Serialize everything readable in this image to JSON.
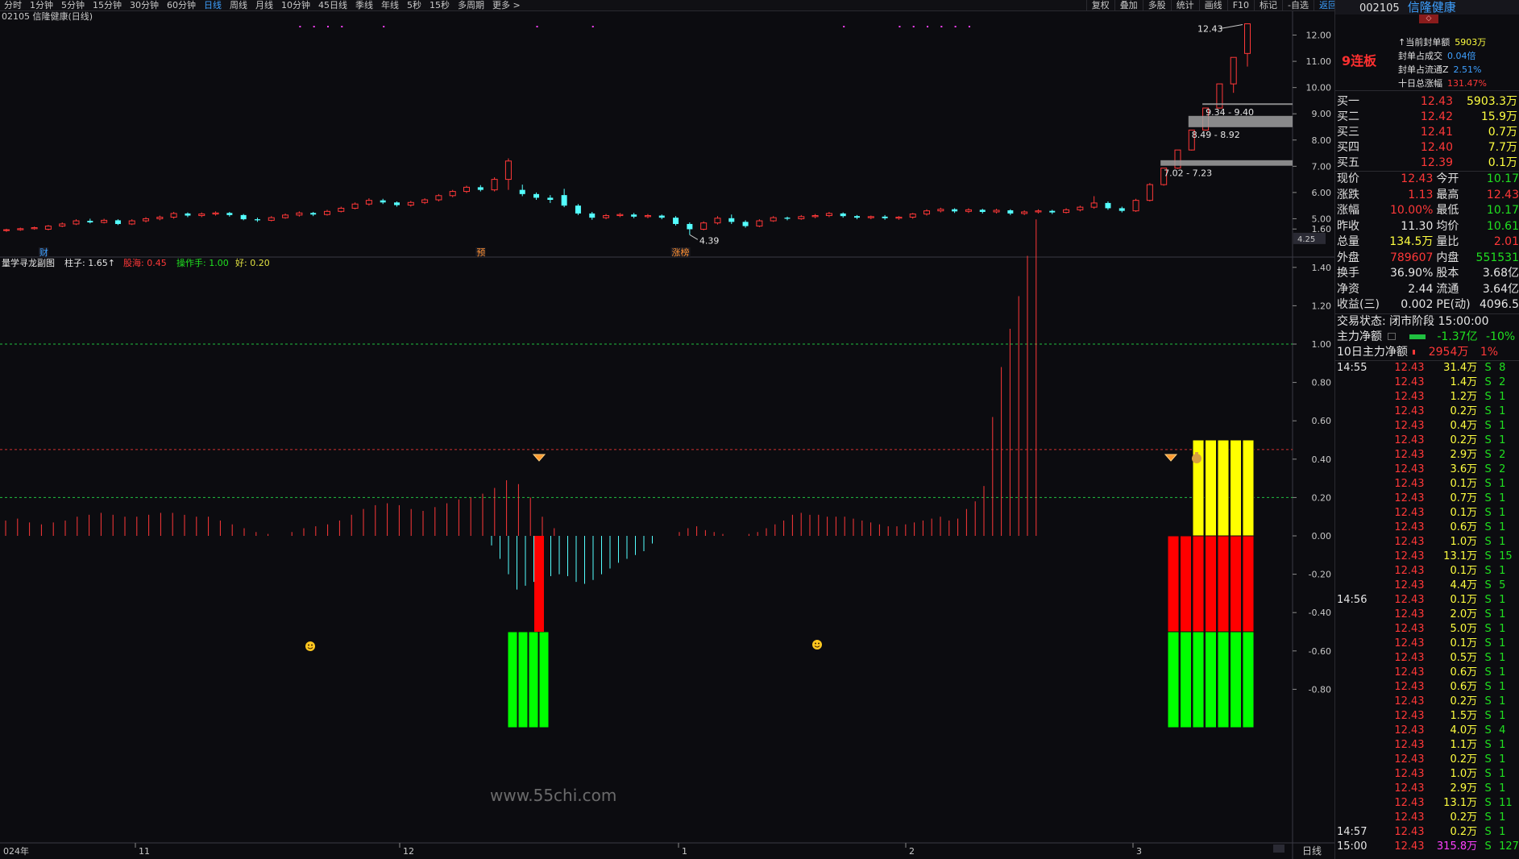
{
  "period_tabs": [
    {
      "label": "分时",
      "active": false
    },
    {
      "label": "1分钟",
      "active": false
    },
    {
      "label": "5分钟",
      "active": false
    },
    {
      "label": "15分钟",
      "active": false
    },
    {
      "label": "30分钟",
      "active": false
    },
    {
      "label": "60分钟",
      "active": false
    },
    {
      "label": "日线",
      "active": true
    },
    {
      "label": "周线",
      "active": false
    },
    {
      "label": "月线",
      "active": false
    },
    {
      "label": "10分钟",
      "active": false
    },
    {
      "label": "45日线",
      "active": false
    },
    {
      "label": "季线",
      "active": false
    },
    {
      "label": "年线",
      "active": false
    },
    {
      "label": "5秒",
      "active": false
    },
    {
      "label": "15秒",
      "active": false
    },
    {
      "label": "多周期",
      "active": false
    },
    {
      "label": "更多 >",
      "active": false
    }
  ],
  "right_tabs": [
    {
      "label": "复权",
      "active": false
    },
    {
      "label": "叠加",
      "active": false
    },
    {
      "label": "多股",
      "active": false
    },
    {
      "label": "统计",
      "active": false
    },
    {
      "label": "画线",
      "active": false
    },
    {
      "label": "F10",
      "active": false
    },
    {
      "label": "标记",
      "active": false
    },
    {
      "label": "-自选",
      "active": false
    },
    {
      "label": "返回",
      "active": true
    }
  ],
  "main_chart": {
    "title": "02105 信隆健康(日线)",
    "price_axis": [
      "12.00",
      "11.00",
      "10.00",
      "9.00",
      "8.00",
      "7.00",
      "6.00",
      "5.00"
    ],
    "last_price_tag": "4.25",
    "annotations": {
      "high": "12.43",
      "low": "4.39"
    },
    "zones": [
      {
        "label": "9.34 - 9.40",
        "lo": 9.34,
        "hi": 9.4
      },
      {
        "label": "8.49 - 8.92",
        "lo": 8.49,
        "hi": 8.92
      },
      {
        "label": "7.02 - 7.23",
        "lo": 7.02,
        "hi": 7.23
      }
    ],
    "markers": [
      {
        "label": "财",
        "index": 3,
        "color": "#3ea0ff"
      },
      {
        "label": "预",
        "index": 34,
        "color": "#ff9030"
      },
      {
        "label": "涨榜",
        "index": 48,
        "color": "#ff9030"
      }
    ],
    "x_axis": [
      "024年",
      "11",
      "12",
      "1",
      "2",
      "3"
    ],
    "period_label": "日线",
    "watermark": "www.55chi.com"
  },
  "indicator": {
    "name": "量学寻龙副图",
    "legend": [
      {
        "text": "柱子: 1.65↑",
        "color": "#e6e6e6"
      },
      {
        "text": "股海: 0.45",
        "color": "#ff3838"
      },
      {
        "text": "操作手: 1.00",
        "color": "#20e020"
      },
      {
        "text": "好: 0.20",
        "color": "#e0e040"
      }
    ],
    "axis": [
      "1.60",
      "1.40",
      "1.20",
      "1.00",
      "0.80",
      "0.60",
      "0.40",
      "0.20",
      "0.00",
      "-0.20",
      "-0.40",
      "-0.60",
      "-0.80"
    ]
  },
  "chart_data": {
    "type": "candlestick",
    "ylim": [
      4.0,
      12.6
    ],
    "candles": [
      [
        4.55,
        4.58,
        4.5,
        4.62
      ],
      [
        4.58,
        4.62,
        4.54,
        4.66
      ],
      [
        4.62,
        4.66,
        4.58,
        4.7
      ],
      [
        4.6,
        4.72,
        4.56,
        4.76
      ],
      [
        4.72,
        4.8,
        4.68,
        4.86
      ],
      [
        4.8,
        4.92,
        4.76,
        4.98
      ],
      [
        4.92,
        4.86,
        4.82,
        5.0
      ],
      [
        4.86,
        4.94,
        4.82,
        5.0
      ],
      [
        4.94,
        4.8,
        4.76,
        4.98
      ],
      [
        4.8,
        4.92,
        4.76,
        4.98
      ],
      [
        4.92,
        5.0,
        4.86,
        5.06
      ],
      [
        5.0,
        5.06,
        4.94,
        5.12
      ],
      [
        5.06,
        5.2,
        5.0,
        5.26
      ],
      [
        5.2,
        5.12,
        5.06,
        5.24
      ],
      [
        5.12,
        5.18,
        5.06,
        5.24
      ],
      [
        5.18,
        5.22,
        5.12,
        5.28
      ],
      [
        5.22,
        5.14,
        5.08,
        5.26
      ],
      [
        5.14,
        4.98,
        4.94,
        5.18
      ],
      [
        4.98,
        4.94,
        4.88,
        5.04
      ],
      [
        4.94,
        5.04,
        4.9,
        5.1
      ],
      [
        5.04,
        5.14,
        5.0,
        5.2
      ],
      [
        5.14,
        5.22,
        5.08,
        5.28
      ],
      [
        5.22,
        5.16,
        5.1,
        5.26
      ],
      [
        5.16,
        5.28,
        5.12,
        5.34
      ],
      [
        5.28,
        5.4,
        5.24,
        5.46
      ],
      [
        5.4,
        5.56,
        5.36,
        5.62
      ],
      [
        5.56,
        5.7,
        5.5,
        5.78
      ],
      [
        5.7,
        5.62,
        5.56,
        5.76
      ],
      [
        5.62,
        5.52,
        5.46,
        5.66
      ],
      [
        5.52,
        5.62,
        5.46,
        5.68
      ],
      [
        5.62,
        5.72,
        5.56,
        5.78
      ],
      [
        5.72,
        5.88,
        5.66,
        5.94
      ],
      [
        5.88,
        6.04,
        5.82,
        6.1
      ],
      [
        6.04,
        6.2,
        5.98,
        6.26
      ],
      [
        6.2,
        6.1,
        6.04,
        6.28
      ],
      [
        6.1,
        6.5,
        6.04,
        6.58
      ],
      [
        6.5,
        7.2,
        6.1,
        7.3
      ],
      [
        6.1,
        5.94,
        5.86,
        6.3
      ],
      [
        5.94,
        5.8,
        5.72,
        6.0
      ],
      [
        5.8,
        5.72,
        5.6,
        5.9
      ],
      [
        5.9,
        5.5,
        5.44,
        6.14
      ],
      [
        5.5,
        5.2,
        5.14,
        5.56
      ],
      [
        5.2,
        5.04,
        4.96,
        5.26
      ],
      [
        5.04,
        5.12,
        4.98,
        5.18
      ],
      [
        5.12,
        5.16,
        5.06,
        5.22
      ],
      [
        5.16,
        5.08,
        5.02,
        5.22
      ],
      [
        5.08,
        5.12,
        5.02,
        5.18
      ],
      [
        5.12,
        5.04,
        4.98,
        5.16
      ],
      [
        5.04,
        4.8,
        4.74,
        5.1
      ],
      [
        4.8,
        4.6,
        4.39,
        4.86
      ],
      [
        4.6,
        4.84,
        4.56,
        4.9
      ],
      [
        4.84,
        5.02,
        4.78,
        5.1
      ],
      [
        5.02,
        4.88,
        4.8,
        5.16
      ],
      [
        4.88,
        4.72,
        4.66,
        4.94
      ],
      [
        4.72,
        4.92,
        4.68,
        4.98
      ],
      [
        4.92,
        5.04,
        4.88,
        5.1
      ],
      [
        5.04,
        5.0,
        4.94,
        5.08
      ],
      [
        5.0,
        5.08,
        4.96,
        5.14
      ],
      [
        5.08,
        5.12,
        5.02,
        5.18
      ],
      [
        5.12,
        5.2,
        5.06,
        5.26
      ],
      [
        5.2,
        5.1,
        5.04,
        5.24
      ],
      [
        5.1,
        5.04,
        4.98,
        5.14
      ],
      [
        5.04,
        5.08,
        4.98,
        5.12
      ],
      [
        5.08,
        5.02,
        4.96,
        5.14
      ],
      [
        5.02,
        5.06,
        4.96,
        5.1
      ],
      [
        5.06,
        5.18,
        5.0,
        5.22
      ],
      [
        5.18,
        5.3,
        5.12,
        5.36
      ],
      [
        5.3,
        5.36,
        5.24,
        5.42
      ],
      [
        5.36,
        5.28,
        5.22,
        5.4
      ],
      [
        5.28,
        5.34,
        5.22,
        5.4
      ],
      [
        5.34,
        5.26,
        5.2,
        5.38
      ],
      [
        5.26,
        5.32,
        5.2,
        5.38
      ],
      [
        5.32,
        5.2,
        5.14,
        5.36
      ],
      [
        5.2,
        5.26,
        5.14,
        5.32
      ],
      [
        5.26,
        5.3,
        5.2,
        5.36
      ],
      [
        5.3,
        5.24,
        5.18,
        5.34
      ],
      [
        5.24,
        5.34,
        5.2,
        5.4
      ],
      [
        5.34,
        5.44,
        5.28,
        5.5
      ],
      [
        5.44,
        5.6,
        5.38,
        5.86
      ],
      [
        5.6,
        5.4,
        5.34,
        5.66
      ],
      [
        5.4,
        5.3,
        5.24,
        5.46
      ],
      [
        5.3,
        5.7,
        5.26,
        5.76
      ],
      [
        5.7,
        6.3,
        5.66,
        6.36
      ],
      [
        6.3,
        6.93,
        6.26,
        6.93
      ],
      [
        6.93,
        7.62,
        6.9,
        7.62
      ],
      [
        7.62,
        8.38,
        7.6,
        8.38
      ],
      [
        8.38,
        9.22,
        8.36,
        9.22
      ],
      [
        9.22,
        10.14,
        9.2,
        10.14
      ],
      [
        10.14,
        11.15,
        9.8,
        11.15
      ],
      [
        11.3,
        12.43,
        10.8,
        12.43
      ]
    ],
    "colors": {
      "up": "#ff3838",
      "down": "#54ffff"
    }
  },
  "indicator_data": {
    "red_bars": [
      0.08,
      0.09,
      0.07,
      0.06,
      0.07,
      0.08,
      0.1,
      0.11,
      0.12,
      0.11,
      0.1,
      0.1,
      0.11,
      0.12,
      0.12,
      0.11,
      0.1,
      0.1,
      0.08,
      0.06,
      0.04,
      0.02,
      0.01,
      0.0,
      0.02,
      0.04,
      0.05,
      0.06,
      0.08,
      0.11,
      0.14,
      0.16,
      0.17,
      0.16,
      0.14,
      0.13,
      0.15,
      0.17,
      0.19,
      0.2,
      0.22,
      0.25,
      0.29,
      0.27,
      0.2,
      0.1,
      0.04
    ],
    "cyan_bars": [
      -0.05,
      -0.12,
      -0.2,
      -0.28,
      -0.26,
      -0.24,
      -0.22,
      -0.21,
      -0.2,
      -0.21,
      -0.24,
      -0.25,
      -0.23,
      -0.2,
      -0.17,
      -0.14,
      -0.12,
      -0.1,
      -0.08,
      -0.04
    ],
    "late_red_bars": [
      0.02,
      0.04,
      0.05,
      0.03,
      0.02,
      0.01,
      0.0,
      0.0,
      0.01,
      0.02,
      0.04,
      0.06,
      0.08,
      0.11,
      0.12,
      0.11,
      0.11,
      0.1,
      0.1,
      0.1,
      0.09,
      0.08,
      0.07,
      0.06,
      0.05,
      0.05,
      0.06,
      0.07,
      0.08,
      0.09,
      0.1,
      0.08,
      0.09,
      0.14,
      0.18,
      0.26,
      0.62,
      0.88,
      1.08,
      1.25,
      1.46,
      1.65
    ],
    "hlines": {
      "ref_1": 1.0,
      "ref_045": 0.45,
      "ref_02": 0.2
    },
    "blocks": [
      {
        "start": 21,
        "count": 4,
        "red_top": 0.0,
        "red_bottom": -0.5,
        "green_bottom": -1.0,
        "red_only_index": 23
      },
      {
        "start": 43,
        "count": 7,
        "yellow_top": 0.5,
        "red_bottom": -0.5,
        "green_bottom": -1.0,
        "yellow_from": 45
      }
    ]
  },
  "stock_header": {
    "code": "002105",
    "name": "信隆健康"
  },
  "limit_board": {
    "board_label": "9连板",
    "rows": [
      {
        "label": "↑当前封单额",
        "value": "5903万",
        "color": "#ffff40"
      },
      {
        "label": "封单占成交",
        "value": "0.04倍",
        "color": "#3ea0ff"
      },
      {
        "label": "封单占流通Z",
        "value": "2.51%",
        "color": "#3ea0ff"
      },
      {
        "label": "十日总涨幅",
        "value": "131.47%",
        "color": "#ff3838"
      }
    ]
  },
  "order_book": [
    {
      "label": "买一",
      "price": "12.43",
      "volume": "5903.3万"
    },
    {
      "label": "买二",
      "price": "12.42",
      "volume": "15.9万"
    },
    {
      "label": "买三",
      "price": "12.41",
      "volume": "0.7万"
    },
    {
      "label": "买四",
      "price": "12.40",
      "volume": "7.7万"
    },
    {
      "label": "买五",
      "price": "12.39",
      "volume": "0.1万"
    }
  ],
  "quote": [
    {
      "l1": "现价",
      "v1": "12.43",
      "c1": "#ff3838",
      "l2": "今开",
      "v2": "10.17",
      "c2": "#20e020"
    },
    {
      "l1": "涨跌",
      "v1": "1.13",
      "c1": "#ff3838",
      "l2": "最高",
      "v2": "12.43",
      "c2": "#ff3838"
    },
    {
      "l1": "涨幅",
      "v1": "10.00%",
      "c1": "#ff3838",
      "l2": "最低",
      "v2": "10.17",
      "c2": "#20e020"
    },
    {
      "l1": "昨收",
      "v1": "11.30",
      "c1": "#e6e6e6",
      "l2": "均价",
      "v2": "10.61",
      "c2": "#20e020"
    },
    {
      "l1": "总量",
      "v1": "134.5万",
      "c1": "#ffff40",
      "l2": "量比",
      "v2": "2.01",
      "c2": "#ff3838"
    },
    {
      "l1": "外盘",
      "v1": "789607",
      "c1": "#ff3838",
      "l2": "内盘",
      "v2": "551531",
      "c2": "#20e020"
    },
    {
      "l1": "换手",
      "v1": "36.90%",
      "c1": "#e6e6e6",
      "l2": "股本",
      "v2": "3.68亿",
      "c2": "#e6e6e6"
    },
    {
      "l1": "净资",
      "v1": "2.44",
      "c1": "#e6e6e6",
      "l2": "流通",
      "v2": "3.64亿",
      "c2": "#e6e6e6"
    },
    {
      "l1": "收益(三)",
      "v1": "0.002",
      "c1": "#e6e6e6",
      "l2": "PE(动)",
      "v2": "4096.5",
      "c2": "#e6e6e6"
    }
  ],
  "flow": {
    "status": "交易状态: 闭市阶段 15:00:00",
    "main_label": "主力净额",
    "main_value": "-1.37亿",
    "main_pct": "-10%",
    "ten_label": "10日主力净额",
    "ten_value": "2954万",
    "ten_pct": "1%"
  },
  "ticks": [
    {
      "time": "14:55",
      "price": "12.43",
      "vol": "31.4万",
      "side": "S",
      "n": "8"
    },
    {
      "time": "",
      "price": "12.43",
      "vol": "1.4万",
      "side": "S",
      "n": "2"
    },
    {
      "time": "",
      "price": "12.43",
      "vol": "1.2万",
      "side": "S",
      "n": "1"
    },
    {
      "time": "",
      "price": "12.43",
      "vol": "0.2万",
      "side": "S",
      "n": "1"
    },
    {
      "time": "",
      "price": "12.43",
      "vol": "0.4万",
      "side": "S",
      "n": "1"
    },
    {
      "time": "",
      "price": "12.43",
      "vol": "0.2万",
      "side": "S",
      "n": "1"
    },
    {
      "time": "",
      "price": "12.43",
      "vol": "2.9万",
      "side": "S",
      "n": "2"
    },
    {
      "time": "",
      "price": "12.43",
      "vol": "3.6万",
      "side": "S",
      "n": "2"
    },
    {
      "time": "",
      "price": "12.43",
      "vol": "0.1万",
      "side": "S",
      "n": "1"
    },
    {
      "time": "",
      "price": "12.43",
      "vol": "0.7万",
      "side": "S",
      "n": "1"
    },
    {
      "time": "",
      "price": "12.43",
      "vol": "0.1万",
      "side": "S",
      "n": "1"
    },
    {
      "time": "",
      "price": "12.43",
      "vol": "0.6万",
      "side": "S",
      "n": "1"
    },
    {
      "time": "",
      "price": "12.43",
      "vol": "1.0万",
      "side": "S",
      "n": "1"
    },
    {
      "time": "",
      "price": "12.43",
      "vol": "13.1万",
      "side": "S",
      "n": "15"
    },
    {
      "time": "",
      "price": "12.43",
      "vol": "0.1万",
      "side": "S",
      "n": "1"
    },
    {
      "time": "",
      "price": "12.43",
      "vol": "4.4万",
      "side": "S",
      "n": "5"
    },
    {
      "time": "14:56",
      "price": "12.43",
      "vol": "0.1万",
      "side": "S",
      "n": "1"
    },
    {
      "time": "",
      "price": "12.43",
      "vol": "2.0万",
      "side": "S",
      "n": "1"
    },
    {
      "time": "",
      "price": "12.43",
      "vol": "5.0万",
      "side": "S",
      "n": "1"
    },
    {
      "time": "",
      "price": "12.43",
      "vol": "0.1万",
      "side": "S",
      "n": "1"
    },
    {
      "time": "",
      "price": "12.43",
      "vol": "0.5万",
      "side": "S",
      "n": "1"
    },
    {
      "time": "",
      "price": "12.43",
      "vol": "0.6万",
      "side": "S",
      "n": "1"
    },
    {
      "time": "",
      "price": "12.43",
      "vol": "0.6万",
      "side": "S",
      "n": "1"
    },
    {
      "time": "",
      "price": "12.43",
      "vol": "0.2万",
      "side": "S",
      "n": "1"
    },
    {
      "time": "",
      "price": "12.43",
      "vol": "1.5万",
      "side": "S",
      "n": "1"
    },
    {
      "time": "",
      "price": "12.43",
      "vol": "4.0万",
      "side": "S",
      "n": "4"
    },
    {
      "time": "",
      "price": "12.43",
      "vol": "1.1万",
      "side": "S",
      "n": "1"
    },
    {
      "time": "",
      "price": "12.43",
      "vol": "0.2万",
      "side": "S",
      "n": "1"
    },
    {
      "time": "",
      "price": "12.43",
      "vol": "1.0万",
      "side": "S",
      "n": "1"
    },
    {
      "time": "",
      "price": "12.43",
      "vol": "2.9万",
      "side": "S",
      "n": "1"
    },
    {
      "time": "",
      "price": "12.43",
      "vol": "13.1万",
      "side": "S",
      "n": "11"
    },
    {
      "time": "",
      "price": "12.43",
      "vol": "0.2万",
      "side": "S",
      "n": "1"
    },
    {
      "time": "14:57",
      "price": "12.43",
      "vol": "0.2万",
      "side": "S",
      "n": "1"
    },
    {
      "time": "15:00",
      "price": "12.43",
      "vol": "315.8万",
      "side": "S",
      "n": "127"
    }
  ]
}
